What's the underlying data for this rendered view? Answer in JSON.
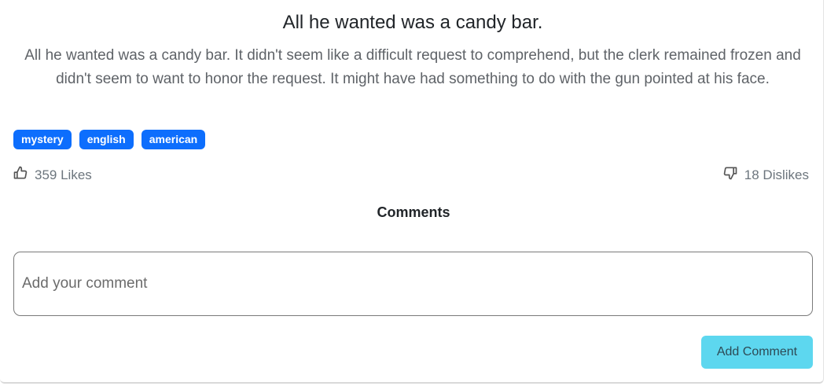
{
  "post": {
    "title": "All he wanted was a candy bar.",
    "body": "All he wanted was a candy bar. It didn't seem like a difficult request to comprehend, but the clerk remained frozen and didn't seem to want to honor the request. It might have had something to do with the gun pointed at his face.",
    "tags": [
      "mystery",
      "english",
      "american"
    ],
    "likes_label": "359 Likes",
    "dislikes_label": "18 Dislikes"
  },
  "comments": {
    "heading": "Comments",
    "placeholder": "Add your comment",
    "value": "",
    "submit_label": "Add Comment"
  },
  "icons": {
    "like": "thumbs-up-icon",
    "dislike": "thumbs-down-icon"
  },
  "colors": {
    "tag_bg": "#0d6efd",
    "button_bg": "#5dd7ef"
  }
}
